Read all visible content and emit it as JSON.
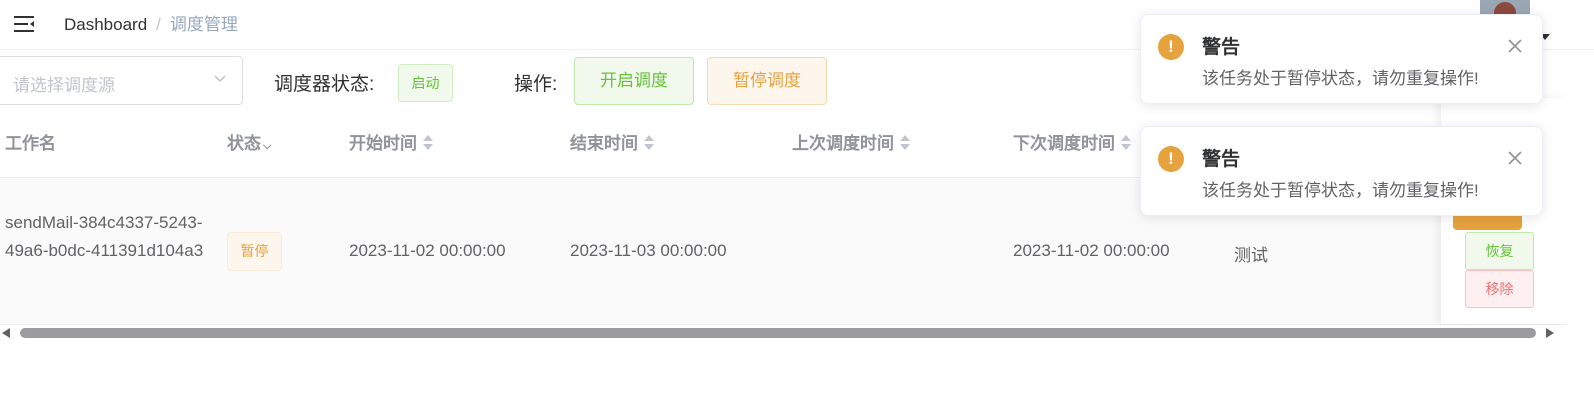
{
  "navbar": {
    "breadcrumb": {
      "home": "Dashboard",
      "separator": "/",
      "current": "调度管理"
    }
  },
  "toolbar": {
    "source_select_placeholder": "请选择调度源",
    "scheduler_status_label": "调度器状态:",
    "scheduler_status_value": "启动",
    "operations_label": "操作:",
    "start_button": "开启调度",
    "pause_button": "暂停调度"
  },
  "table": {
    "columns": [
      "工作名",
      "状态",
      "开始时间",
      "结束时间",
      "上次调度时间",
      "下次调度时间"
    ],
    "rows": [
      {
        "job_name": "sendMail-384c4337-5243-49a6-b0dc-411391d104a3",
        "status": "暂停",
        "start_time": "2023-11-02 00:00:00",
        "end_time": "2023-11-03 00:00:00",
        "last_schedule_time": "",
        "next_schedule_time": "2023-11-02 00:00:00",
        "remark": "测试",
        "actions": {
          "resume": "恢复",
          "remove": "移除"
        }
      }
    ]
  },
  "notifications": [
    {
      "title": "警告",
      "message": "该任务处于暂停状态，请勿重复操作!",
      "type": "warning"
    },
    {
      "title": "警告",
      "message": "该任务处于暂停状态，请勿重复操作!",
      "type": "warning"
    }
  ],
  "colors": {
    "success": "#67c23a",
    "warning": "#e6a23c",
    "danger": "#f56c6c",
    "header_text": "#909399"
  }
}
